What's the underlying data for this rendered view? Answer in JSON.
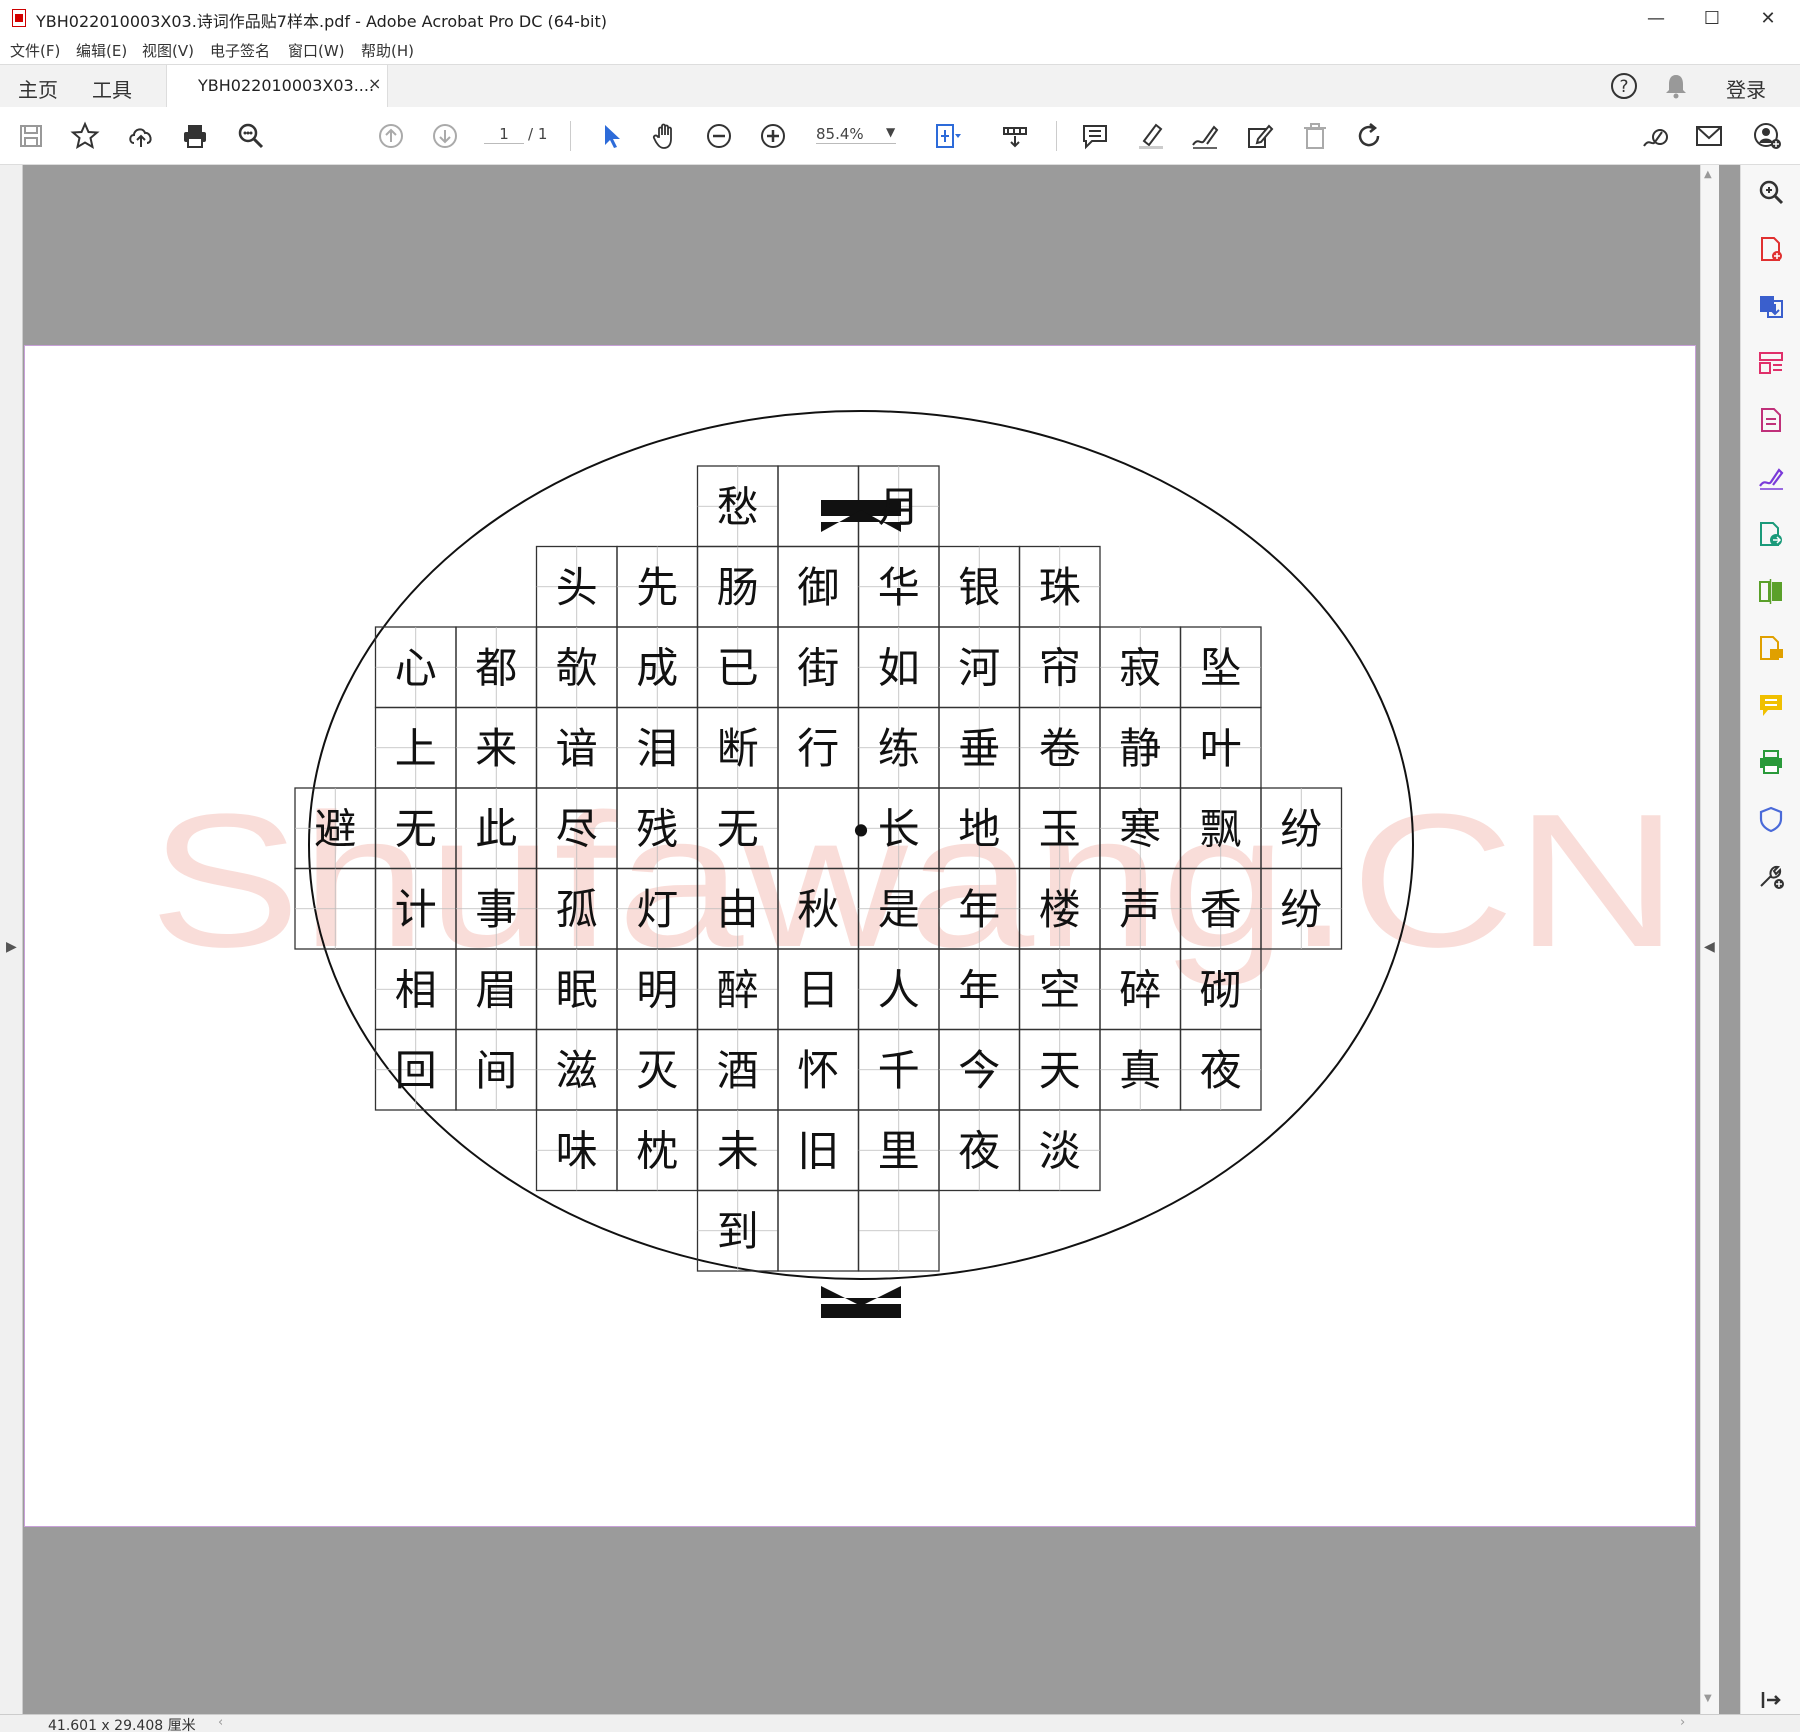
{
  "window": {
    "title": "YBH022010003X03.诗词作品贴7样本.pdf - Adobe Acrobat Pro DC (64-bit)",
    "minimize": "—",
    "maximize": "☐",
    "close": "✕"
  },
  "menu": [
    "文件(F)",
    "编辑(E)",
    "视图(V)",
    "电子签名",
    "窗口(W)",
    "帮助(H)"
  ],
  "tabs": {
    "home": "主页",
    "tools": "工具",
    "document": "YBH022010003X03....",
    "document_close": "×",
    "login": "登录"
  },
  "toolbar": {
    "page_current": "1",
    "page_total": "/ 1",
    "zoom": "85.4%"
  },
  "status": {
    "page_size": "41.601 x 29.408 厘米"
  },
  "document": {
    "watermark": "Shufawang.CN",
    "center_dot": "•",
    "columns": [
      {
        "col": 0,
        "row_start": 4,
        "chars": [
          "避"
        ],
        "blank_rows": [
          5
        ]
      },
      {
        "col": 1,
        "row_start": 2,
        "chars": [
          "心",
          "上",
          "无",
          "计",
          "相",
          "回"
        ]
      },
      {
        "col": 2,
        "row_start": 2,
        "chars": [
          "都",
          "来",
          "此",
          "事",
          "眉",
          "间"
        ]
      },
      {
        "col": 3,
        "row_start": 1,
        "chars": [
          "头",
          "欹",
          "谙",
          "尽",
          "孤",
          "眠",
          "滋",
          "味"
        ]
      },
      {
        "col": 4,
        "row_start": 1,
        "chars": [
          "先",
          "成",
          "泪",
          "残",
          "灯",
          "明",
          "灭",
          "枕"
        ]
      },
      {
        "col": 5,
        "row_start": 0,
        "chars": [
          "愁",
          "肠",
          "已",
          "断",
          "无",
          "由",
          "醉",
          "酒",
          "未",
          "到"
        ]
      },
      {
        "col": 6,
        "row_start": 1,
        "chars": [
          "御",
          "街",
          "行",
          "",
          "秋",
          "日",
          "怀",
          "旧"
        ]
      },
      {
        "col": 7,
        "row_start": 0,
        "chars": [
          "月",
          "华",
          "如",
          "练",
          "长",
          "是",
          "人",
          "千",
          "里",
          ""
        ]
      },
      {
        "col": 8,
        "row_start": 1,
        "chars": [
          "银",
          "河",
          "垂",
          "地",
          "年",
          "年",
          "今",
          "夜"
        ]
      },
      {
        "col": 9,
        "row_start": 1,
        "chars": [
          "珠",
          "帘",
          "卷",
          "玉",
          "楼",
          "空",
          "天",
          "淡"
        ]
      },
      {
        "col": 10,
        "row_start": 2,
        "chars": [
          "寂",
          "静",
          "寒",
          "声",
          "碎",
          "真"
        ]
      },
      {
        "col": 11,
        "row_start": 2,
        "chars": [
          "坠",
          "叶",
          "飘",
          "香",
          "砌",
          "夜"
        ]
      },
      {
        "col": 12,
        "row_start": 4,
        "chars": [
          "纷",
          "纷"
        ]
      }
    ]
  },
  "colors": {
    "page_border": "#c8a0d8",
    "doc_background": "#9b9b9b",
    "watermark": "#f6c8c0",
    "accent_blue": "#2d6bd9"
  },
  "icons": {
    "toolbar": [
      "save-icon",
      "star-icon",
      "cloud-upload-icon",
      "print-icon",
      "search-zoom-icon",
      "page-up-icon",
      "page-down-icon",
      "select-arrow-icon",
      "hand-icon",
      "zoom-out-icon",
      "zoom-in-icon",
      "fit-page-icon",
      "tools-menu-icon",
      "comment-icon",
      "highlight-icon",
      "sign-icon",
      "edit-stamp-icon",
      "delete-icon",
      "rotate-icon",
      "share-link-icon",
      "email-icon",
      "add-user-icon"
    ],
    "right_panel": [
      "search-panel-icon",
      "export-pdf-icon",
      "create-pdf-icon",
      "edit-pdf-icon",
      "organize-icon",
      "fill-sign-icon",
      "combine-icon",
      "compare-icon",
      "export-icon",
      "comment-panel-icon",
      "scan-icon",
      "protect-icon",
      "more-tools-icon",
      "expand-panel-icon"
    ]
  }
}
